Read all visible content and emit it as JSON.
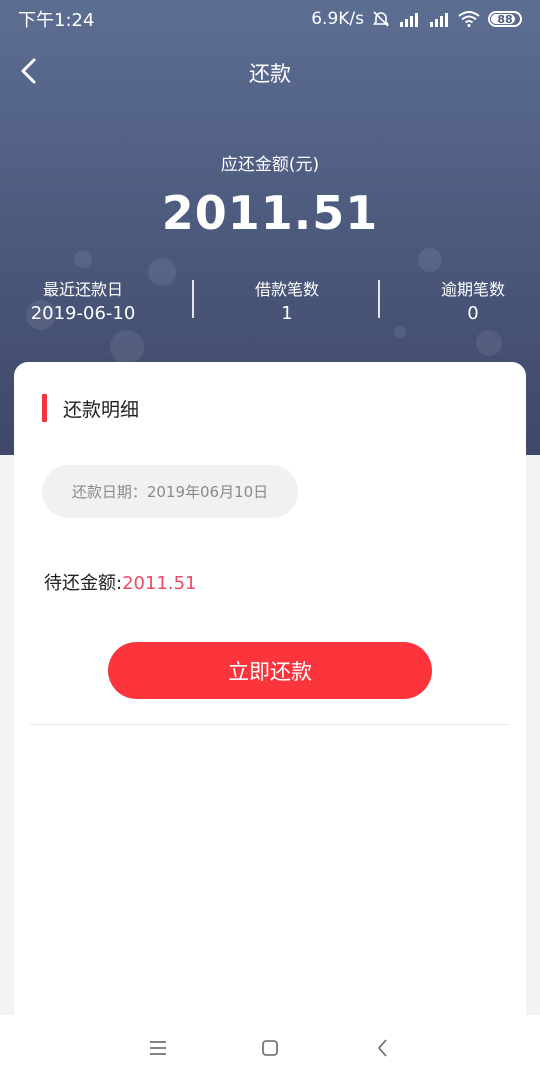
{
  "status_bar": {
    "time": "下午1:24",
    "net_speed": "6.9K/s",
    "battery": "88",
    "battery_level": 0.88
  },
  "navbar": {
    "title": "还款",
    "back_icon": "chevron-left-icon"
  },
  "summary": {
    "due_label": "应还金额(元)",
    "due_amount": "2011.51",
    "stats": [
      {
        "label": "最近还款日",
        "value": "2019-06-10"
      },
      {
        "label": "借款笔数",
        "value": "1"
      },
      {
        "label": "逾期笔数",
        "value": "0"
      }
    ]
  },
  "detail": {
    "section_title": "还款明细",
    "date_pill": "还款日期：2019年06月10日",
    "pending_label": "待还金额:",
    "pending_value": "2011.51",
    "pay_button": "立即还款"
  },
  "system_nav": {
    "icons": [
      "menu-icon",
      "home-square-icon",
      "back-icon"
    ]
  },
  "colors": {
    "header_top": "#5d6e93",
    "header_bottom": "#3f4868",
    "accent_red": "#fc343b",
    "amount_pink": "#ea4b62"
  }
}
